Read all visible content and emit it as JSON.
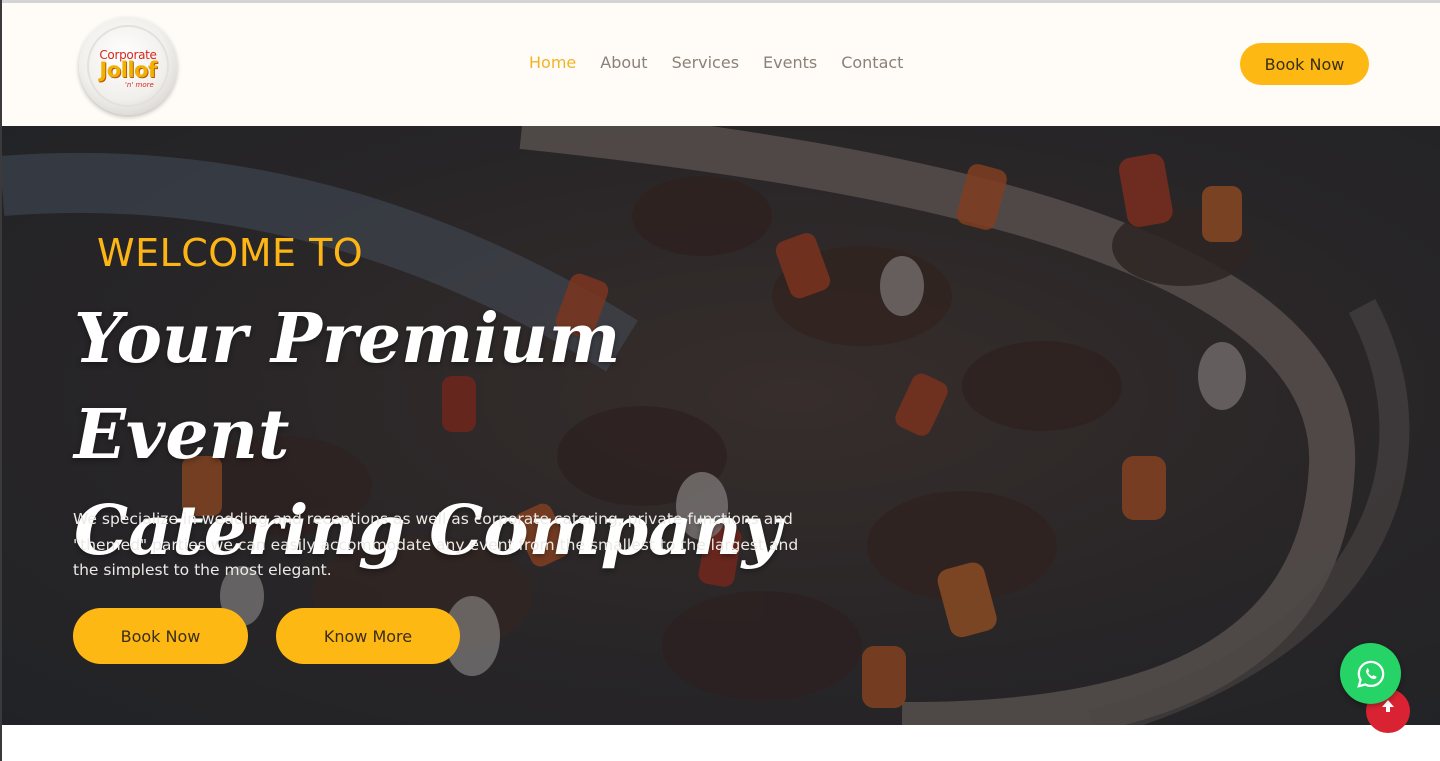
{
  "brand": {
    "logo_top": "Corporate",
    "logo_main": "Jollof",
    "logo_sub": "'n' more"
  },
  "nav": {
    "items": [
      {
        "label": "Home",
        "active": true
      },
      {
        "label": "About",
        "active": false
      },
      {
        "label": "Services",
        "active": false
      },
      {
        "label": "Events",
        "active": false
      },
      {
        "label": "Contact",
        "active": false
      }
    ],
    "book_label": "Book Now"
  },
  "hero": {
    "welcome": "WELCOME TO",
    "headline_line1": "Your Premium Event",
    "headline_line2": "Catering Company",
    "description": "We specialize in wedding and receptions as well as corporate catering, private functions and \"themed\" parties we can easily accommodate any event from the smallest to the largest and the simplest to the most elegant.",
    "book_label": "Book Now",
    "know_label": "Know More"
  },
  "floating": {
    "whatsapp_icon": "whatsapp-icon",
    "back_to_top_icon": "arrow-up-icon"
  },
  "colors": {
    "accent": "#fdb813",
    "nav_active": "#f2b324",
    "nav_text": "#8a8178",
    "header_bg": "#fffcf7",
    "whatsapp": "#25d366",
    "back_to_top": "#d92332"
  }
}
